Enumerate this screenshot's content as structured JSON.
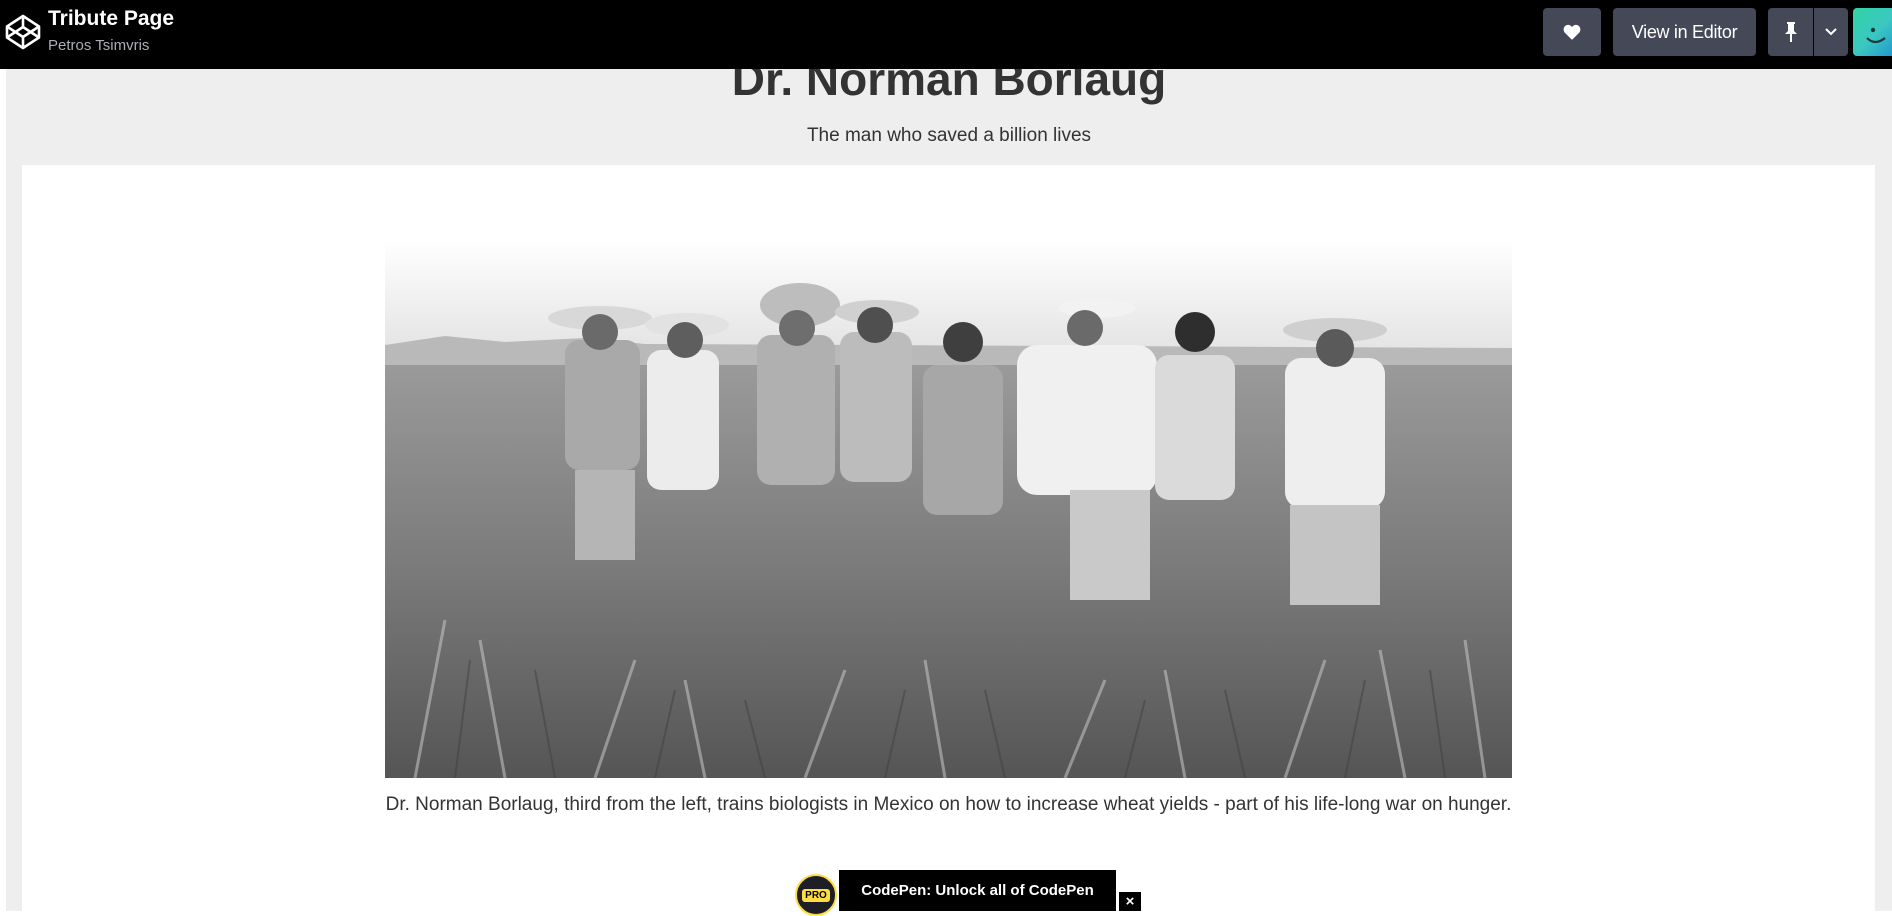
{
  "topbar": {
    "title": "Tribute Page",
    "author": "Petros Tsimvris",
    "view_in_editor_label": "View in Editor"
  },
  "icons": {
    "logo": "codepen-logo-icon",
    "heart": "heart-icon",
    "pin": "pin-icon",
    "dropdown": "chevron-down-icon",
    "close": "close-icon"
  },
  "page": {
    "heading": "Dr. Norman Borlaug",
    "subtitle": "The man who saved a billion lives",
    "caption": "Dr. Norman Borlaug, third from the left, trains biologists in Mexico on how to increase wheat yields - part of his life-long war on hunger."
  },
  "promo": {
    "badge": "PRO",
    "text": "CodePen: Unlock all of CodePen",
    "close": "×"
  },
  "colors": {
    "topbar_bg": "#000000",
    "button_bg": "#444857",
    "page_bg": "#eeeeee",
    "card_bg": "#ffffff",
    "text": "#333333",
    "pro_yellow": "#ffdd40"
  }
}
